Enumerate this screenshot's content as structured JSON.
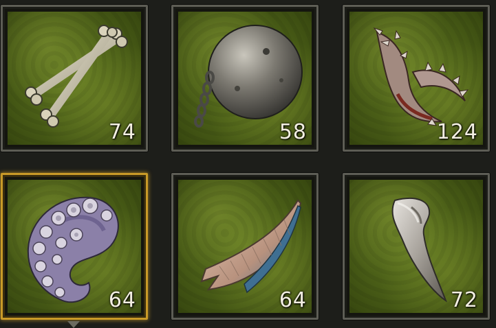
{
  "inventory": {
    "slots": [
      {
        "item": "crossed-bones",
        "count": "74",
        "selected": false
      },
      {
        "item": "iron-ball-and-chain",
        "count": "58",
        "selected": false
      },
      {
        "item": "spiked-claw",
        "count": "124",
        "selected": false
      },
      {
        "item": "tentacle",
        "count": "64",
        "selected": true
      },
      {
        "item": "wing-feather",
        "count": "64",
        "selected": false
      },
      {
        "item": "fang",
        "count": "72",
        "selected": false
      }
    ]
  },
  "colors": {
    "slot_border": "#5d5d55",
    "selected_border": "#c99a28",
    "slot_background": "#4a5e17",
    "count_text": "#f3efe2"
  }
}
